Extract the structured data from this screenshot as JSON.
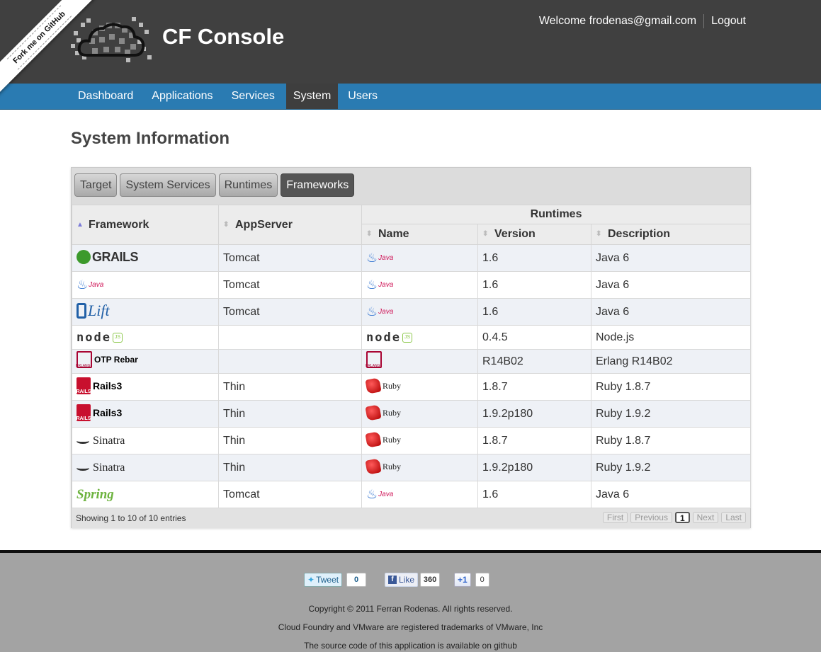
{
  "ribbon": "Fork me on GitHub",
  "header": {
    "title": "CF Console",
    "welcome": "Welcome frodenas@gmail.com",
    "logout": "Logout"
  },
  "nav": [
    "Dashboard",
    "Applications",
    "Services",
    "System",
    "Users"
  ],
  "nav_active": "System",
  "page_title": "System Information",
  "tabs": [
    "Target",
    "System Services",
    "Runtimes",
    "Frameworks"
  ],
  "tab_active": "Frameworks",
  "table": {
    "headers": {
      "framework": "Framework",
      "appserver": "AppServer",
      "runtimes": "Runtimes",
      "name": "Name",
      "version": "Version",
      "description": "Description"
    },
    "rows": [
      {
        "framework": "GRAILS",
        "framework_icon": "grails-logo",
        "appserver": "Tomcat",
        "runtime": "Java",
        "runtime_icon": "java-logo",
        "version": "1.6",
        "description": "Java 6"
      },
      {
        "framework": "Java",
        "framework_icon": "java-logo",
        "appserver": "Tomcat",
        "runtime": "Java",
        "runtime_icon": "java-logo",
        "version": "1.6",
        "description": "Java 6"
      },
      {
        "framework": "Lift",
        "framework_icon": "lift-logo",
        "appserver": "Tomcat",
        "runtime": "Java",
        "runtime_icon": "java-logo",
        "version": "1.6",
        "description": "Java 6"
      },
      {
        "framework": "node",
        "framework_icon": "node-logo",
        "appserver": "",
        "runtime": "node",
        "runtime_icon": "node-logo",
        "version": "0.4.5",
        "description": "Node.js"
      },
      {
        "framework": "OTP Rebar",
        "framework_icon": "erlang-logo",
        "appserver": "",
        "runtime": "",
        "runtime_icon": "erlang-logo",
        "version": "R14B02",
        "description": "Erlang R14B02"
      },
      {
        "framework": "Rails3",
        "framework_icon": "rails-logo",
        "appserver": "Thin",
        "runtime": "Ruby",
        "runtime_icon": "ruby-logo",
        "version": "1.8.7",
        "description": "Ruby 1.8.7"
      },
      {
        "framework": "Rails3",
        "framework_icon": "rails-logo",
        "appserver": "Thin",
        "runtime": "Ruby",
        "runtime_icon": "ruby-logo",
        "version": "1.9.2p180",
        "description": "Ruby 1.9.2"
      },
      {
        "framework": "Sinatra",
        "framework_icon": "sinatra-logo",
        "appserver": "Thin",
        "runtime": "Ruby",
        "runtime_icon": "ruby-logo",
        "version": "1.8.7",
        "description": "Ruby 1.8.7"
      },
      {
        "framework": "Sinatra",
        "framework_icon": "sinatra-logo",
        "appserver": "Thin",
        "runtime": "Ruby",
        "runtime_icon": "ruby-logo",
        "version": "1.9.2p180",
        "description": "Ruby 1.9.2"
      },
      {
        "framework": "Spring",
        "framework_icon": "spring-logo",
        "appserver": "Tomcat",
        "runtime": "Java",
        "runtime_icon": "java-logo",
        "version": "1.6",
        "description": "Java 6"
      }
    ],
    "info": "Showing 1 to 10 of 10 entries",
    "pager": [
      "First",
      "Previous",
      "1",
      "Next",
      "Last"
    ]
  },
  "footer": {
    "tweet_label": "Tweet",
    "tweet_count": "0",
    "like_label": "Like",
    "like_count": "360",
    "plusone_label": "+1",
    "plusone_count": "0",
    "copyright": "Copyright © 2011 Ferran Rodenas. All rights reserved.",
    "trademark": "Cloud Foundry and VMware are registered trademarks of VMware, Inc",
    "source": "The source code of this application is available on github"
  },
  "colors": {
    "header_bg": "#404040",
    "nav_bg": "#2a7bb2",
    "footer_bg": "#a3a3a3"
  }
}
